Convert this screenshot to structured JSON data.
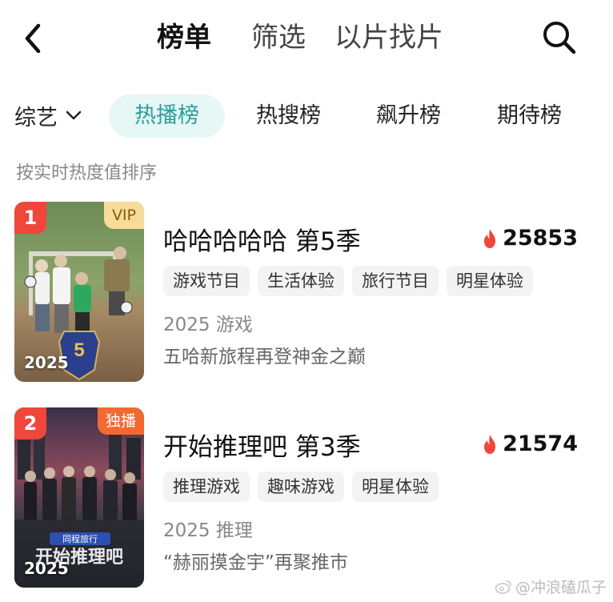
{
  "nav": {
    "tabs": [
      {
        "label": "榜单",
        "active": true
      },
      {
        "label": "筛选",
        "active": false
      },
      {
        "label": "以片找片",
        "active": false
      }
    ],
    "icons": {
      "back": "back-chevron-icon",
      "search": "search-icon"
    }
  },
  "filter": {
    "category": "综艺",
    "rank_tabs": [
      "热播榜",
      "热搜榜",
      "飙升榜",
      "期待榜"
    ],
    "active_rank_tab": "热播榜"
  },
  "sort_hint": "按实时热度值排序",
  "items": [
    {
      "rank": "1",
      "corner_tag": "VIP",
      "poster_year": "2025",
      "title": "哈哈哈哈哈 第5季",
      "heat": "25853",
      "tags": [
        "游戏节目",
        "生活体验",
        "旅行节目",
        "明星体验"
      ],
      "meta": "2025 游戏",
      "description": "五哈新旅程再登神金之巅"
    },
    {
      "rank": "2",
      "corner_tag": "独播",
      "poster_year": "2025",
      "title": "开始推理吧 第3季",
      "heat": "21574",
      "tags": [
        "推理游戏",
        "趣味游戏",
        "明星体验"
      ],
      "meta": "2025 推理",
      "description": "“赫丽摸金宇”再聚推市"
    }
  ],
  "watermark": "@冲浪磕瓜子",
  "colors": {
    "accent": "#2a9f97",
    "accent_bg": "#e6f7f6",
    "rank_badge": "#f0463b",
    "heat_flame": "#f0463b",
    "vip_tag": "#f6dc98",
    "exclusive_tag": "#f26a32"
  }
}
